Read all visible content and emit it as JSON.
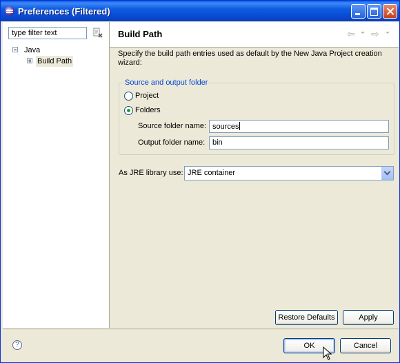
{
  "window": {
    "title": "Preferences (Filtered)"
  },
  "sidebar": {
    "filter_placeholder": "type filter text",
    "tree": [
      {
        "label": "Java",
        "expanded": true
      },
      {
        "label": "Build Path",
        "expanded": false,
        "selected": true
      }
    ]
  },
  "page": {
    "title": "Build Path",
    "description": "Specify the build path entries used as default by the New Java Project creation wizard:",
    "group_title": "Source and output folder",
    "radio_project": "Project",
    "radio_folders": "Folders",
    "selected_radio": "Folders",
    "source_label": "Source folder name:",
    "source_value": "sources",
    "output_label": "Output folder name:",
    "output_value": "bin",
    "jre_label": "As JRE library use:",
    "jre_value": "JRE container",
    "restore_defaults": "Restore Defaults",
    "apply": "Apply"
  },
  "footer": {
    "ok": "OK",
    "cancel": "Cancel",
    "help_glyph": "?"
  },
  "colors": {
    "title_bar": "#0a5ae6",
    "group_title": "#0046d5",
    "window_bg": "#ece9d8"
  }
}
